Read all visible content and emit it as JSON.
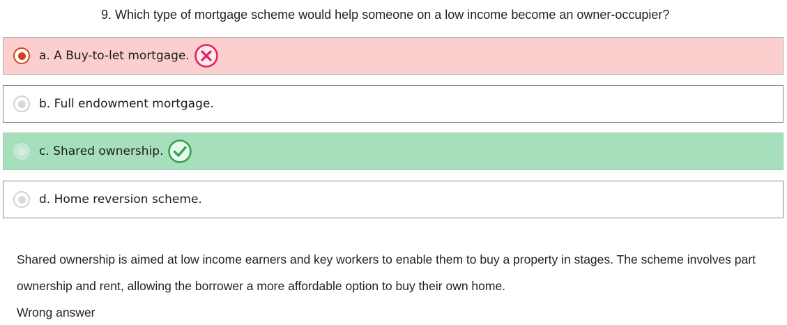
{
  "question": {
    "number": "9.",
    "text": "9. Which type of mortgage scheme would help someone on a low income become an owner-occupier?"
  },
  "options": [
    {
      "letter": "a",
      "label": "a. A Buy-to-let mortgage.",
      "state": "selected-wrong",
      "mark": "x-circle-icon"
    },
    {
      "letter": "b",
      "label": "b. Full endowment mortgage.",
      "state": "unselected"
    },
    {
      "letter": "c",
      "label": "c. Shared ownership.",
      "state": "correct",
      "mark": "check-circle-icon"
    },
    {
      "letter": "d",
      "label": "d. Home reversion scheme.",
      "state": "unselected"
    }
  ],
  "explanation": "Shared ownership is aimed at low income earners and key workers to enable them to buy a property in stages. The scheme involves part ownership and rent, allowing the borrower a more affordable option to buy their own home.",
  "feedback": "Wrong answer",
  "colors": {
    "wrong_bg": "#fccfcf",
    "correct_bg": "#a7dfbd",
    "wrong_accent": "#e0245e",
    "correct_accent": "#2ea44f",
    "selected_radio": "#d2401a"
  }
}
